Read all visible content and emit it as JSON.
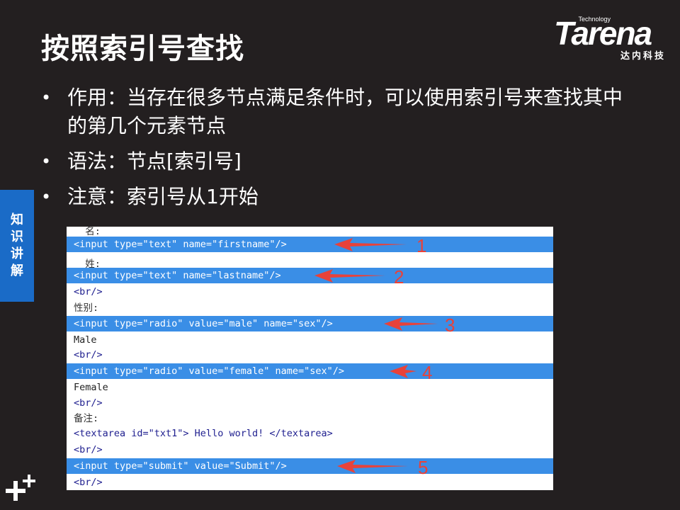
{
  "slide": {
    "title": "按照索引号查找",
    "logo": {
      "word": "Tarena",
      "tagline": "Technology",
      "cn": "达内科技"
    },
    "side_tab": [
      "知",
      "识",
      "讲",
      "解"
    ],
    "bullets": [
      "作用：当存在很多节点满足条件时，可以使用索引号来查找其中的第几个元素节点",
      "语法：节点[索引号]",
      "注意：索引号从1开始"
    ]
  },
  "code": {
    "lines": [
      {
        "text": "  名:",
        "kind": "label"
      },
      {
        "text": "<input type=\"text\" name=\"firstname\"/>",
        "kind": "hl",
        "marker": "1"
      },
      {
        "text": "  姓:",
        "kind": "label"
      },
      {
        "text": "<input type=\"text\" name=\"lastname\"/>",
        "kind": "hl",
        "marker": "2"
      },
      {
        "text": "<br/>",
        "kind": "plain"
      },
      {
        "text": "性别:",
        "kind": "label"
      },
      {
        "text": "<input type=\"radio\" value=\"male\" name=\"sex\"/>",
        "kind": "hl",
        "marker": "3"
      },
      {
        "text": "Male",
        "kind": "text"
      },
      {
        "text": "<br/>",
        "kind": "plain"
      },
      {
        "text": "<input type=\"radio\" value=\"female\" name=\"sex\"/>",
        "kind": "hl",
        "marker": "4"
      },
      {
        "text": "Female",
        "kind": "text"
      },
      {
        "text": "<br/>",
        "kind": "plain"
      },
      {
        "text": "备注:",
        "kind": "label"
      },
      {
        "text": "<textarea id=\"txt1\"> Hello world! </textarea>",
        "kind": "plain"
      },
      {
        "text": "<br/>",
        "kind": "plain"
      },
      {
        "text": "<input type=\"submit\" value=\"Submit\"/>",
        "kind": "hl",
        "marker": "5"
      },
      {
        "text": "<br/>",
        "kind": "plain"
      }
    ]
  },
  "colors": {
    "background": "#231f20",
    "accent": "#1a6bc7",
    "highlight": "#3a8ee6",
    "arrow": "#e8423a"
  }
}
